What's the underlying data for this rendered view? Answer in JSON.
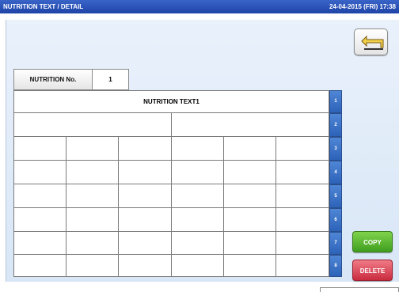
{
  "titlebar": {
    "title": "NUTRITION TEXT / DETAIL",
    "datetime": "24-04-2015 (FRI) 17:38"
  },
  "nutrition_no": {
    "label": "NUTRITION No.",
    "value": "1"
  },
  "grid": {
    "row1_text": "NUTRITION TEXT1",
    "row_numbers": [
      "1",
      "2",
      "3",
      "4",
      "5",
      "6",
      "7",
      "8"
    ]
  },
  "buttons": {
    "copy": "COPY",
    "delete": "DELETE"
  },
  "colors": {
    "titlebar": "#2a52b8",
    "row_number": "#3a72c8",
    "copy": "#5cb832",
    "delete": "#e04a5c"
  },
  "icons": {
    "back": "return-arrow-icon"
  }
}
